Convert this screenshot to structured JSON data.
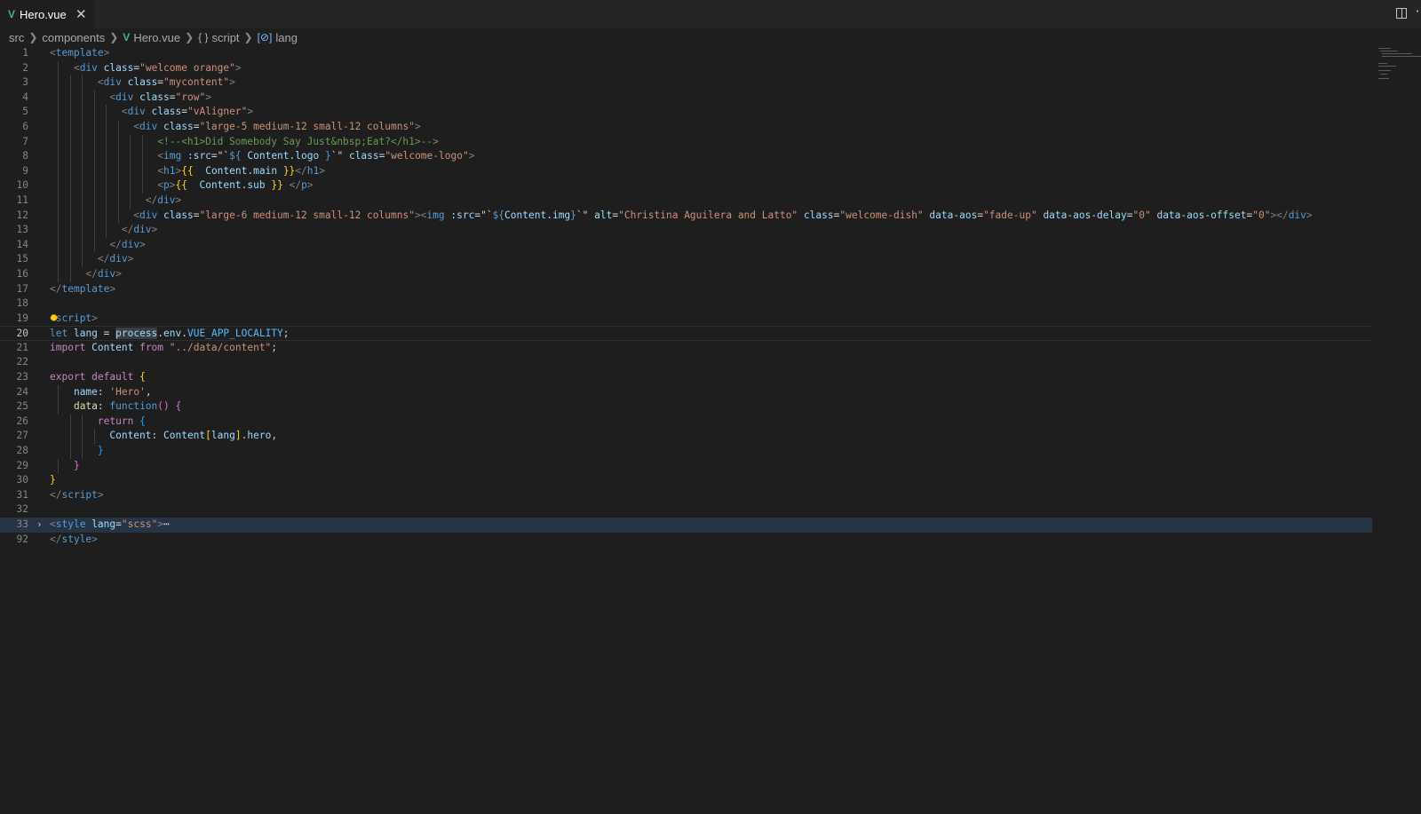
{
  "tab": {
    "filename": "Hero.vue",
    "close_label": "✕"
  },
  "breadcrumb": {
    "items": [
      "src",
      "components",
      "Hero.vue",
      "script",
      "lang"
    ],
    "script_icon": "{ }",
    "var_icon": "[⊘]"
  },
  "editor": {
    "current_line": 20,
    "lines": [
      {
        "n": "1",
        "segs": [
          [
            "t-bracket",
            "<"
          ],
          [
            "t-tag",
            "template"
          ],
          [
            "t-bracket",
            ">"
          ]
        ]
      },
      {
        "n": "2",
        "segs": [
          [
            "t-plain",
            "    "
          ],
          [
            "t-bracket",
            "<"
          ],
          [
            "t-tag",
            "div"
          ],
          [
            "t-plain",
            " "
          ],
          [
            "t-attr",
            "class"
          ],
          [
            "t-plain",
            "="
          ],
          [
            "t-str",
            "\"welcome orange\""
          ],
          [
            "t-bracket",
            ">"
          ]
        ]
      },
      {
        "n": "3",
        "segs": [
          [
            "t-plain",
            "        "
          ],
          [
            "t-bracket",
            "<"
          ],
          [
            "t-tag",
            "div"
          ],
          [
            "t-plain",
            " "
          ],
          [
            "t-attr",
            "class"
          ],
          [
            "t-plain",
            "="
          ],
          [
            "t-str",
            "\"mycontent\""
          ],
          [
            "t-bracket",
            ">"
          ]
        ]
      },
      {
        "n": "4",
        "segs": [
          [
            "t-plain",
            "          "
          ],
          [
            "t-bracket",
            "<"
          ],
          [
            "t-tag",
            "div"
          ],
          [
            "t-plain",
            " "
          ],
          [
            "t-attr",
            "class"
          ],
          [
            "t-plain",
            "="
          ],
          [
            "t-str",
            "\"row\""
          ],
          [
            "t-bracket",
            ">"
          ]
        ]
      },
      {
        "n": "5",
        "segs": [
          [
            "t-plain",
            "            "
          ],
          [
            "t-bracket",
            "<"
          ],
          [
            "t-tag",
            "div"
          ],
          [
            "t-plain",
            " "
          ],
          [
            "t-attr",
            "class"
          ],
          [
            "t-plain",
            "="
          ],
          [
            "t-str",
            "\"vAligner\""
          ],
          [
            "t-bracket",
            ">"
          ]
        ]
      },
      {
        "n": "6",
        "segs": [
          [
            "t-plain",
            "              "
          ],
          [
            "t-bracket",
            "<"
          ],
          [
            "t-tag",
            "div"
          ],
          [
            "t-plain",
            " "
          ],
          [
            "t-attr",
            "class"
          ],
          [
            "t-plain",
            "="
          ],
          [
            "t-str",
            "\"large-5 medium-12 small-12 columns\""
          ],
          [
            "t-bracket",
            ">"
          ]
        ]
      },
      {
        "n": "7",
        "segs": [
          [
            "t-plain",
            "                  "
          ],
          [
            "t-com",
            "<!--<h1>Did Somebody Say Just&nbsp;Eat?</h1>-->"
          ]
        ]
      },
      {
        "n": "8",
        "segs": [
          [
            "t-plain",
            "                  "
          ],
          [
            "t-bracket",
            "<"
          ],
          [
            "t-tag",
            "img"
          ],
          [
            "t-plain",
            " "
          ],
          [
            "t-attr",
            ":src"
          ],
          [
            "t-plain",
            "=\"`"
          ],
          [
            "t-kwb",
            "${"
          ],
          [
            "t-plain",
            " "
          ],
          [
            "t-var",
            "Content"
          ],
          [
            "t-plain",
            "."
          ],
          [
            "t-var",
            "logo"
          ],
          [
            "t-plain",
            " "
          ],
          [
            "t-kwb",
            "}"
          ],
          [
            "t-plain",
            "`\" "
          ],
          [
            "t-attr",
            "class"
          ],
          [
            "t-plain",
            "="
          ],
          [
            "t-str",
            "\"welcome-logo\""
          ],
          [
            "t-bracket",
            ">"
          ]
        ]
      },
      {
        "n": "9",
        "segs": [
          [
            "t-plain",
            "                  "
          ],
          [
            "t-bracket",
            "<"
          ],
          [
            "t-tag",
            "h1"
          ],
          [
            "t-bracket",
            ">"
          ],
          [
            "t-brace",
            "{{"
          ],
          [
            "t-plain",
            "  "
          ],
          [
            "t-var",
            "Content"
          ],
          [
            "t-plain",
            "."
          ],
          [
            "t-var",
            "main"
          ],
          [
            "t-plain",
            " "
          ],
          [
            "t-brace",
            "}}"
          ],
          [
            "t-bracket",
            "</"
          ],
          [
            "t-tag",
            "h1"
          ],
          [
            "t-bracket",
            ">"
          ]
        ]
      },
      {
        "n": "10",
        "segs": [
          [
            "t-plain",
            "                  "
          ],
          [
            "t-bracket",
            "<"
          ],
          [
            "t-tag",
            "p"
          ],
          [
            "t-bracket",
            ">"
          ],
          [
            "t-brace",
            "{{"
          ],
          [
            "t-plain",
            "  "
          ],
          [
            "t-var",
            "Content"
          ],
          [
            "t-plain",
            "."
          ],
          [
            "t-var",
            "sub"
          ],
          [
            "t-plain",
            " "
          ],
          [
            "t-brace",
            "}}"
          ],
          [
            "t-plain",
            " "
          ],
          [
            "t-bracket",
            "</"
          ],
          [
            "t-tag",
            "p"
          ],
          [
            "t-bracket",
            ">"
          ]
        ]
      },
      {
        "n": "11",
        "segs": [
          [
            "t-plain",
            "                "
          ],
          [
            "t-bracket",
            "</"
          ],
          [
            "t-tag",
            "div"
          ],
          [
            "t-bracket",
            ">"
          ]
        ]
      },
      {
        "n": "12",
        "segs": [
          [
            "t-plain",
            "              "
          ],
          [
            "t-bracket",
            "<"
          ],
          [
            "t-tag",
            "div"
          ],
          [
            "t-plain",
            " "
          ],
          [
            "t-attr",
            "class"
          ],
          [
            "t-plain",
            "="
          ],
          [
            "t-str",
            "\"large-6 medium-12 small-12 columns\""
          ],
          [
            "t-bracket",
            "><"
          ],
          [
            "t-tag",
            "img"
          ],
          [
            "t-plain",
            " "
          ],
          [
            "t-attr",
            ":src"
          ],
          [
            "t-plain",
            "=\"`"
          ],
          [
            "t-kwb",
            "${"
          ],
          [
            "t-var",
            "Content"
          ],
          [
            "t-plain",
            "."
          ],
          [
            "t-var",
            "img"
          ],
          [
            "t-kwb",
            "}"
          ],
          [
            "t-plain",
            "`\" "
          ],
          [
            "t-attr",
            "alt"
          ],
          [
            "t-plain",
            "="
          ],
          [
            "t-str",
            "\"Christina Aguilera and Latto\""
          ],
          [
            "t-plain",
            " "
          ],
          [
            "t-attr",
            "class"
          ],
          [
            "t-plain",
            "="
          ],
          [
            "t-str",
            "\"welcome-dish\""
          ],
          [
            "t-plain",
            " "
          ],
          [
            "t-attr",
            "data-aos"
          ],
          [
            "t-plain",
            "="
          ],
          [
            "t-str",
            "\"fade-up\""
          ],
          [
            "t-plain",
            " "
          ],
          [
            "t-attr",
            "data-aos-delay"
          ],
          [
            "t-plain",
            "="
          ],
          [
            "t-str",
            "\"0\""
          ],
          [
            "t-plain",
            " "
          ],
          [
            "t-attr",
            "data-aos-offset"
          ],
          [
            "t-plain",
            "="
          ],
          [
            "t-str",
            "\"0\""
          ],
          [
            "t-bracket",
            "></"
          ],
          [
            "t-tag",
            "div"
          ],
          [
            "t-bracket",
            ">"
          ]
        ]
      },
      {
        "n": "13",
        "segs": [
          [
            "t-plain",
            "            "
          ],
          [
            "t-bracket",
            "</"
          ],
          [
            "t-tag",
            "div"
          ],
          [
            "t-bracket",
            ">"
          ]
        ]
      },
      {
        "n": "14",
        "segs": [
          [
            "t-plain",
            "          "
          ],
          [
            "t-bracket",
            "</"
          ],
          [
            "t-tag",
            "div"
          ],
          [
            "t-bracket",
            ">"
          ]
        ]
      },
      {
        "n": "15",
        "segs": [
          [
            "t-plain",
            "        "
          ],
          [
            "t-bracket",
            "</"
          ],
          [
            "t-tag",
            "div"
          ],
          [
            "t-bracket",
            ">"
          ]
        ]
      },
      {
        "n": "16",
        "segs": [
          [
            "t-plain",
            "      "
          ],
          [
            "t-bracket",
            "</"
          ],
          [
            "t-tag",
            "div"
          ],
          [
            "t-bracket",
            ">"
          ]
        ]
      },
      {
        "n": "17",
        "segs": [
          [
            "t-bracket",
            "</"
          ],
          [
            "t-tag",
            "template"
          ],
          [
            "t-bracket",
            ">"
          ]
        ]
      },
      {
        "n": "18",
        "segs": []
      },
      {
        "n": "19",
        "segs": [
          [
            "t-bracket",
            "<"
          ],
          [
            "t-tag",
            "script"
          ],
          [
            "t-bracket",
            ">"
          ]
        ]
      },
      {
        "n": "20",
        "segs": [
          [
            "t-kwb",
            "let"
          ],
          [
            "t-plain",
            " "
          ],
          [
            "t-var",
            "lang"
          ],
          [
            "t-plain",
            " = "
          ],
          [
            "t-hl t-var",
            "process"
          ],
          [
            "t-plain",
            "."
          ],
          [
            "t-var",
            "env"
          ],
          [
            "t-plain",
            "."
          ],
          [
            "t-const",
            "VUE_APP_LOCALITY"
          ],
          [
            "t-plain",
            ";"
          ]
        ]
      },
      {
        "n": "21",
        "segs": [
          [
            "t-kw",
            "import"
          ],
          [
            "t-plain",
            " "
          ],
          [
            "t-var",
            "Content"
          ],
          [
            "t-plain",
            " "
          ],
          [
            "t-kw",
            "from"
          ],
          [
            "t-plain",
            " "
          ],
          [
            "t-str",
            "\"../data/content\""
          ],
          [
            "t-plain",
            ";"
          ]
        ]
      },
      {
        "n": "22",
        "segs": []
      },
      {
        "n": "23",
        "segs": [
          [
            "t-kw",
            "export"
          ],
          [
            "t-plain",
            " "
          ],
          [
            "t-kw",
            "default"
          ],
          [
            "t-plain",
            " "
          ],
          [
            "t-brace",
            "{"
          ]
        ]
      },
      {
        "n": "24",
        "segs": [
          [
            "t-plain",
            "    "
          ],
          [
            "t-var",
            "name"
          ],
          [
            "t-plain",
            ": "
          ],
          [
            "t-str",
            "'Hero'"
          ],
          [
            "t-plain",
            ","
          ]
        ]
      },
      {
        "n": "25",
        "segs": [
          [
            "t-plain",
            "    "
          ],
          [
            "t-fn",
            "data"
          ],
          [
            "t-plain",
            ": "
          ],
          [
            "t-kwb",
            "function"
          ],
          [
            "t-brace2",
            "()"
          ],
          [
            "t-plain",
            " "
          ],
          [
            "t-brace2",
            "{"
          ]
        ]
      },
      {
        "n": "26",
        "segs": [
          [
            "t-plain",
            "        "
          ],
          [
            "t-kw",
            "return"
          ],
          [
            "t-plain",
            " "
          ],
          [
            "t-brace3",
            "{"
          ]
        ]
      },
      {
        "n": "27",
        "segs": [
          [
            "t-plain",
            "          "
          ],
          [
            "t-var",
            "Content"
          ],
          [
            "t-plain",
            ": "
          ],
          [
            "t-var",
            "Content"
          ],
          [
            "t-brace",
            "["
          ],
          [
            "t-var",
            "lang"
          ],
          [
            "t-brace",
            "]"
          ],
          [
            "t-plain",
            "."
          ],
          [
            "t-var",
            "hero"
          ],
          [
            "t-plain",
            ","
          ]
        ]
      },
      {
        "n": "28",
        "segs": [
          [
            "t-plain",
            "        "
          ],
          [
            "t-brace3",
            "}"
          ]
        ]
      },
      {
        "n": "29",
        "segs": [
          [
            "t-plain",
            "    "
          ],
          [
            "t-brace2",
            "}"
          ]
        ]
      },
      {
        "n": "30",
        "segs": [
          [
            "t-brace",
            "}"
          ]
        ]
      },
      {
        "n": "31",
        "segs": [
          [
            "t-bracket",
            "</"
          ],
          [
            "t-tag",
            "script"
          ],
          [
            "t-bracket",
            ">"
          ]
        ]
      },
      {
        "n": "32",
        "segs": []
      },
      {
        "n": "33",
        "segs": [
          [
            "t-bracket",
            "<"
          ],
          [
            "t-tag",
            "style"
          ],
          [
            "t-plain",
            " "
          ],
          [
            "t-attr",
            "lang"
          ],
          [
            "t-plain",
            "="
          ],
          [
            "t-str",
            "\"scss\""
          ],
          [
            "t-bracket",
            ">"
          ],
          [
            "t-plain",
            "⋯"
          ]
        ]
      },
      {
        "n": "92",
        "segs": [
          [
            "t-bracket",
            "</"
          ],
          [
            "t-tag",
            "style"
          ],
          [
            "t-bracket",
            ">"
          ]
        ]
      }
    ]
  }
}
